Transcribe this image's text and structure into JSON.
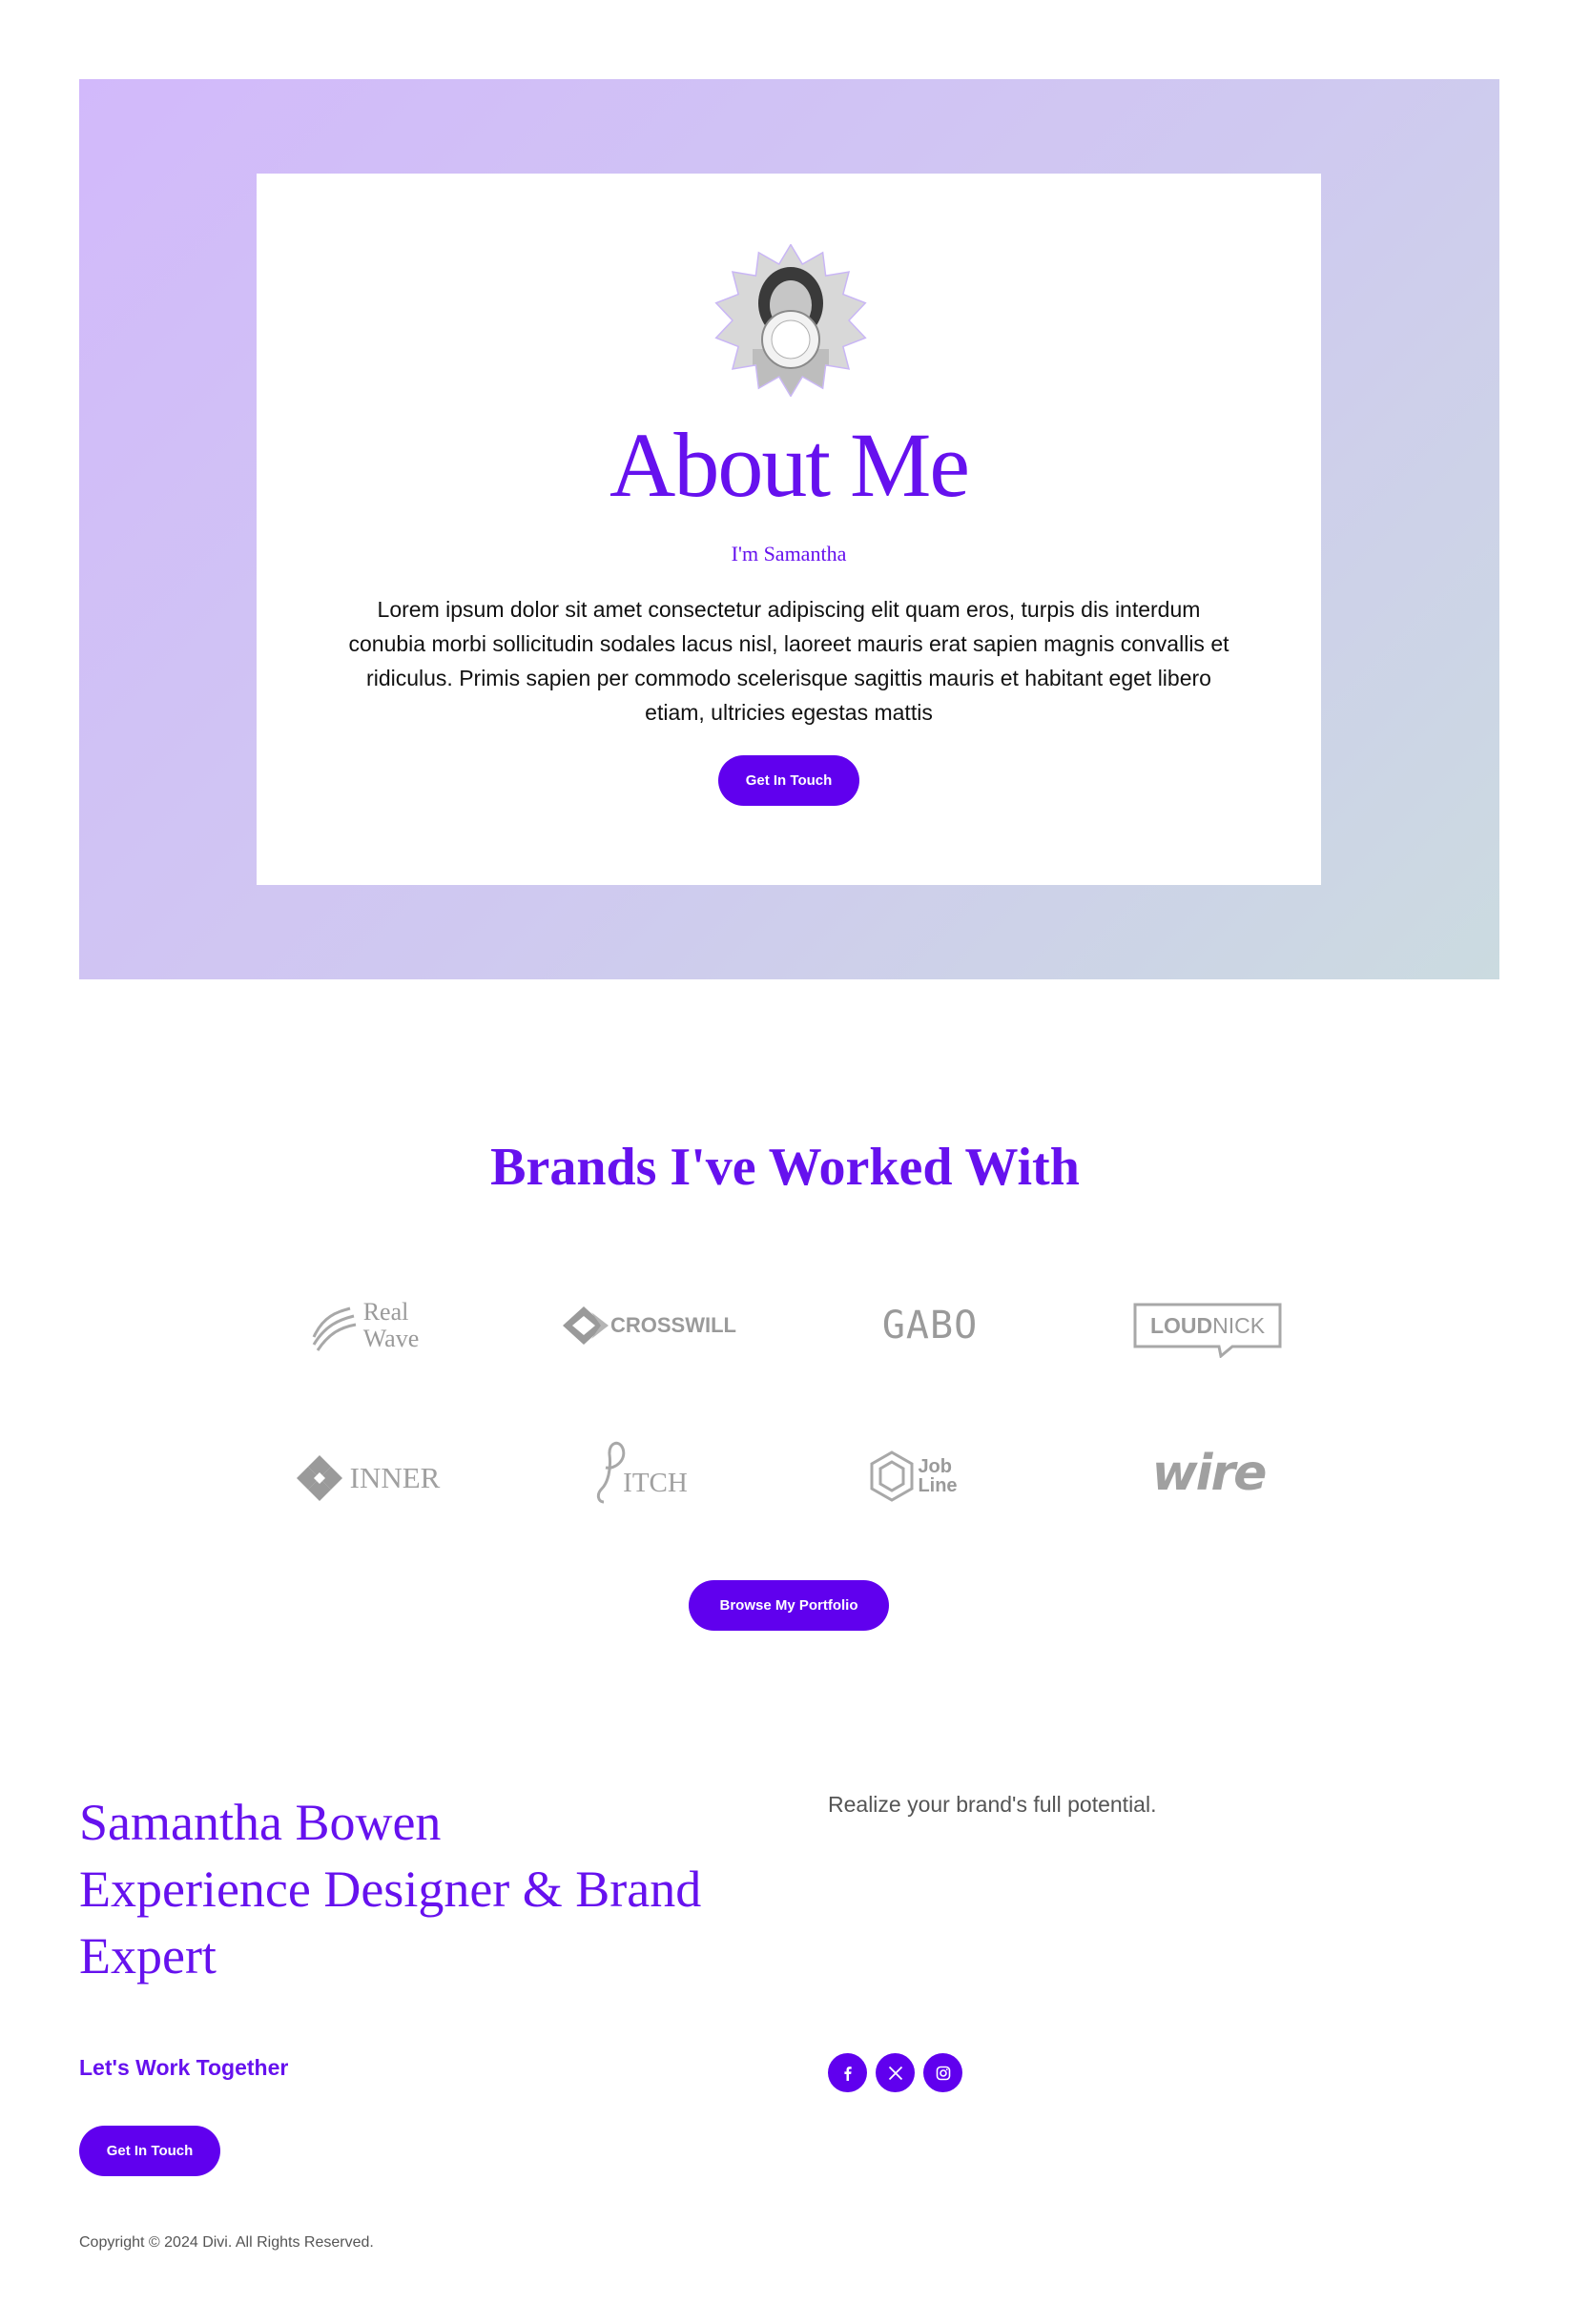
{
  "colors": {
    "accent": "#6000ee",
    "heading": "#6611ee",
    "logo_gray": "#9a9a9a"
  },
  "hero": {
    "title": "About Me",
    "subtitle": "I'm Samantha",
    "body": "Lorem ipsum dolor sit amet consectetur adipiscing elit quam eros, turpis dis interdum conubia morbi sollicitudin sodales lacus nisl, laoreet mauris erat sapien magnis convallis et ridiculus. Primis sapien per commodo scelerisque sagittis mauris et habitant eget libero etiam, ultricies egestas mattis",
    "button": "Get In Touch",
    "avatar_icon": "profile-photo"
  },
  "brands": {
    "title": "Brands I've Worked With",
    "logos": [
      {
        "name": "Real Wave",
        "line1": "Real",
        "line2": "Wave",
        "icon": "wave-icon"
      },
      {
        "name": "CROSSWILL",
        "text": "CROSSWILL",
        "icon": "diamond-icon"
      },
      {
        "name": "GABO",
        "text": "GABO"
      },
      {
        "name": "LOUDNICK",
        "text_bold": "LOUD",
        "text_light": "NICK"
      },
      {
        "name": "INNER",
        "text": "INNER",
        "icon": "diamond-grid-icon"
      },
      {
        "name": "PITCH",
        "text": "ITCH",
        "icon": "script-p-icon"
      },
      {
        "name": "Job Line",
        "line1": "Job",
        "line2": "Line",
        "icon": "hexagon-icon"
      },
      {
        "name": "wire",
        "text": "wire"
      }
    ],
    "button": "Browse My Portfolio"
  },
  "footer": {
    "name_lines": [
      "Samantha Bowen",
      "Experience Designer & Brand",
      "Expert"
    ],
    "tagline": "Realize your brand's full potential.",
    "cta_label": "Let's Work Together",
    "button": "Get In Touch",
    "socials": [
      {
        "name": "facebook",
        "icon": "facebook-icon"
      },
      {
        "name": "x",
        "icon": "x-icon"
      },
      {
        "name": "instagram",
        "icon": "instagram-icon"
      }
    ],
    "copyright": "Copyright © 2024 Divi. All Rights Reserved."
  }
}
